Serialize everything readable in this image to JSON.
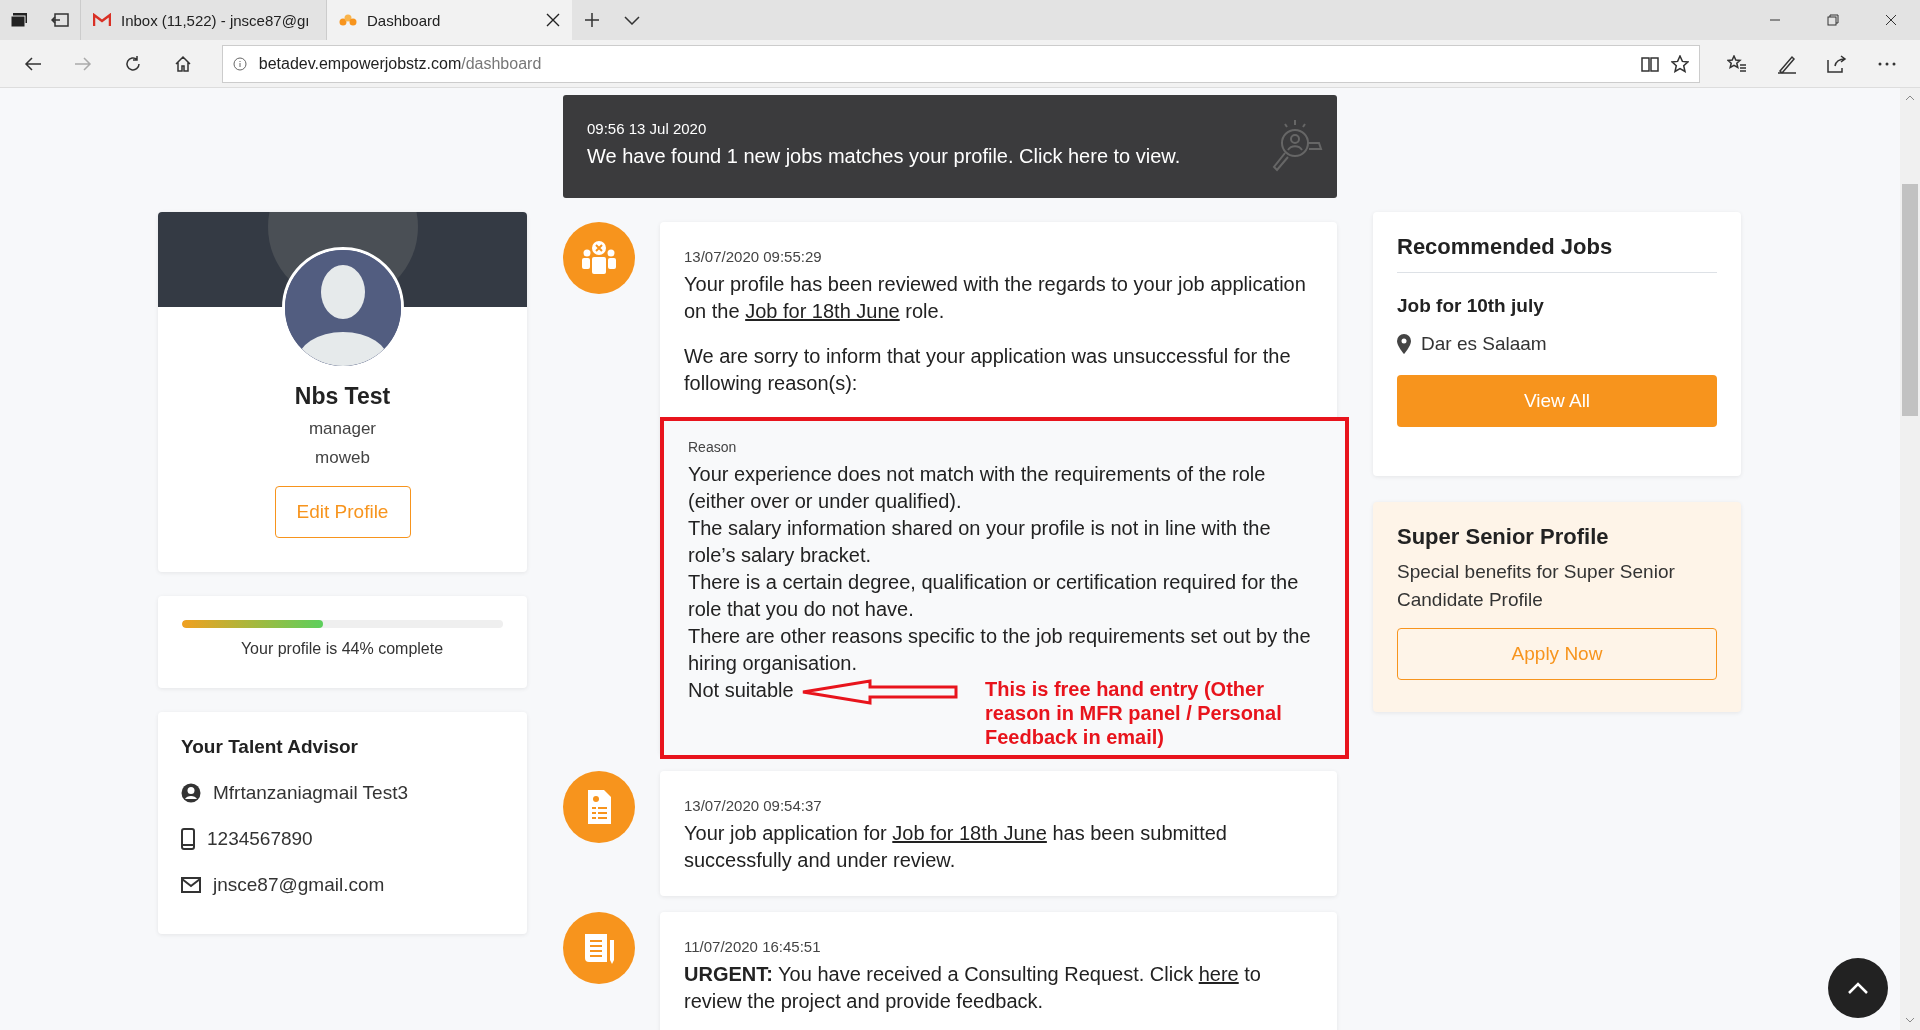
{
  "browser": {
    "tabs": [
      {
        "kind": "mail",
        "label": "Inbox (11,522) - jnsce87@gı",
        "selected": false
      },
      {
        "kind": "site",
        "label": "Dashboard",
        "selected": true
      }
    ],
    "address": {
      "host": "betadev.empowerjobstz.com",
      "path": "/dashboard"
    },
    "forward_disabled": true
  },
  "banner": {
    "time": "09:56 13 Jul 2020",
    "message": "We have found 1 new jobs matches your profile. Click here to view."
  },
  "profile": {
    "name": "Nbs Test",
    "role": "manager",
    "company": "moweb",
    "edit_button": "Edit Profile"
  },
  "completion": {
    "level": 0.44,
    "text": "Your profile is 44% complete"
  },
  "advisor": {
    "title": "Your Talent Advisor",
    "rows": [
      {
        "kind": "person",
        "text": "Mfrtanzaniagmail Test3"
      },
      {
        "kind": "phone",
        "text": "1234567890"
      },
      {
        "kind": "email",
        "text": "jnsce87@gmail.com"
      }
    ]
  },
  "notifications": [
    {
      "kind": "rejected",
      "time": "13/07/2020 09:55:29",
      "paragraphs": [
        [
          {
            "kind": "text",
            "text": "Your profile has been reviewed with the regards to your job application on the "
          },
          {
            "kind": "link",
            "text": "Job for 18th June"
          },
          {
            "kind": "text",
            "text": " role."
          }
        ],
        [
          {
            "kind": "text",
            "text": "We are sorry to inform that your application was unsuccessful for the following reason(s):"
          }
        ]
      ],
      "reason": {
        "label": "Reason",
        "lines": [
          "Your experience does not match with the requirements of the role (either over or under qualified).",
          "The salary information shared on your profile is not in line with the role’s salary bracket.",
          "There is a certain degree, qualification or certification required for the role that you do not have.",
          "There are other reasons specific to the job requirements set out by the hiring organisation.",
          "Not suitable"
        ],
        "annotation": "This is free hand entry (Other reason in MFR panel / Personal Feedback in email)"
      }
    },
    {
      "kind": "application",
      "time": "13/07/2020 09:54:37",
      "paragraphs": [
        [
          {
            "kind": "text",
            "text": "Your job application for "
          },
          {
            "kind": "link",
            "text": "Job for 18th June"
          },
          {
            "kind": "text",
            "text": " has been submitted successfully and under review."
          }
        ]
      ]
    },
    {
      "kind": "request",
      "time": "11/07/2020 16:45:51",
      "paragraphs": [
        [
          {
            "kind": "text",
            "text": "**URGENT:** You have received a Consulting Request. Click "
          },
          {
            "kind": "link",
            "text": "here"
          },
          {
            "kind": "text",
            "text": " to review the project and provide feedback."
          }
        ]
      ]
    }
  ],
  "recommended": {
    "title": "Recommended Jobs",
    "job": "Job for 10th july",
    "location": "Dar es Salaam",
    "button": "View All"
  },
  "super_senior": {
    "title": "Super Senior Profile",
    "description": "Special benefits for Super Senior Candidate Profile",
    "button": "Apply Now"
  }
}
